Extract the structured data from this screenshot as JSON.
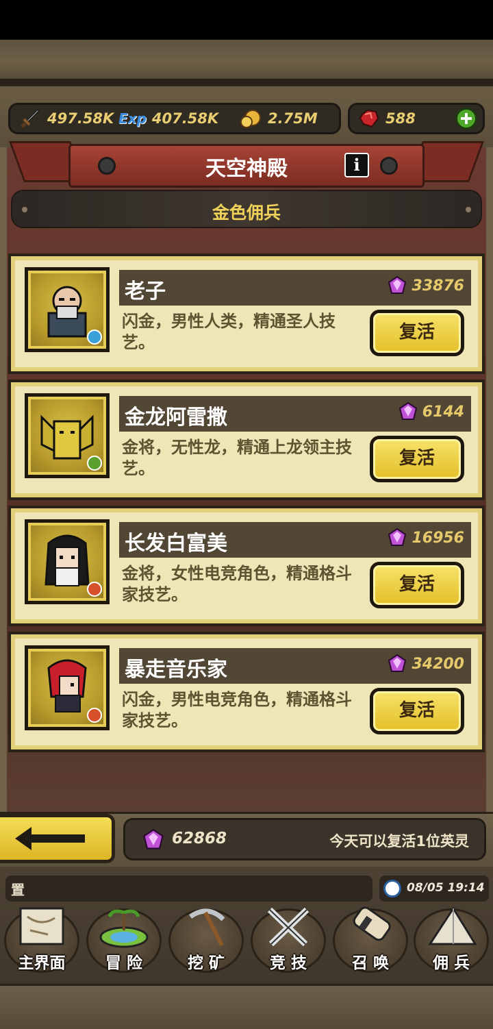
{
  "resources": {
    "attack": "497.58K",
    "exp": "407.58K",
    "gold": "2.75M",
    "gems": "588",
    "exp_icon_text": "Exp"
  },
  "banner": {
    "title": "天空神殿",
    "info_label": "i"
  },
  "section": {
    "title": "金色佣兵"
  },
  "heroes": [
    {
      "name": "老子",
      "cost": "33876",
      "desc": "闪金，男性人类，精通圣人技艺。",
      "button": "复活",
      "badge": "star",
      "color": "#3aa0d8"
    },
    {
      "name": "金龙阿雷撒",
      "cost": "6144",
      "desc": "金将，无性龙，精通上龙领主技艺。",
      "button": "复活",
      "badge": "plus",
      "color": "#5aa02c"
    },
    {
      "name": "长发白富美",
      "cost": "16956",
      "desc": "金将，女性电竞角色，精通格斗家技艺。",
      "button": "复活",
      "badge": "sword",
      "color": "#d8502a"
    },
    {
      "name": "暴走音乐家",
      "cost": "34200",
      "desc": "闪金，男性电竞角色，精通格斗家技艺。",
      "button": "复活",
      "badge": "sword",
      "color": "#d8502a"
    }
  ],
  "footer": {
    "gems": "62868",
    "revive_note": "今天可以复活1位英灵"
  },
  "chat": {
    "message": "置"
  },
  "clock": {
    "time": "08/05 19:14"
  },
  "nav": [
    {
      "label": "主界面",
      "icon": "scroll-map-icon"
    },
    {
      "label": "冒 险",
      "icon": "island-icon"
    },
    {
      "label": "挖 矿",
      "icon": "pickaxe-icon"
    },
    {
      "label": "竞 技",
      "icon": "crossed-swords-icon"
    },
    {
      "label": "召 唤",
      "icon": "summon-scroll-icon"
    },
    {
      "label": "佣 兵",
      "icon": "tent-icon"
    }
  ]
}
